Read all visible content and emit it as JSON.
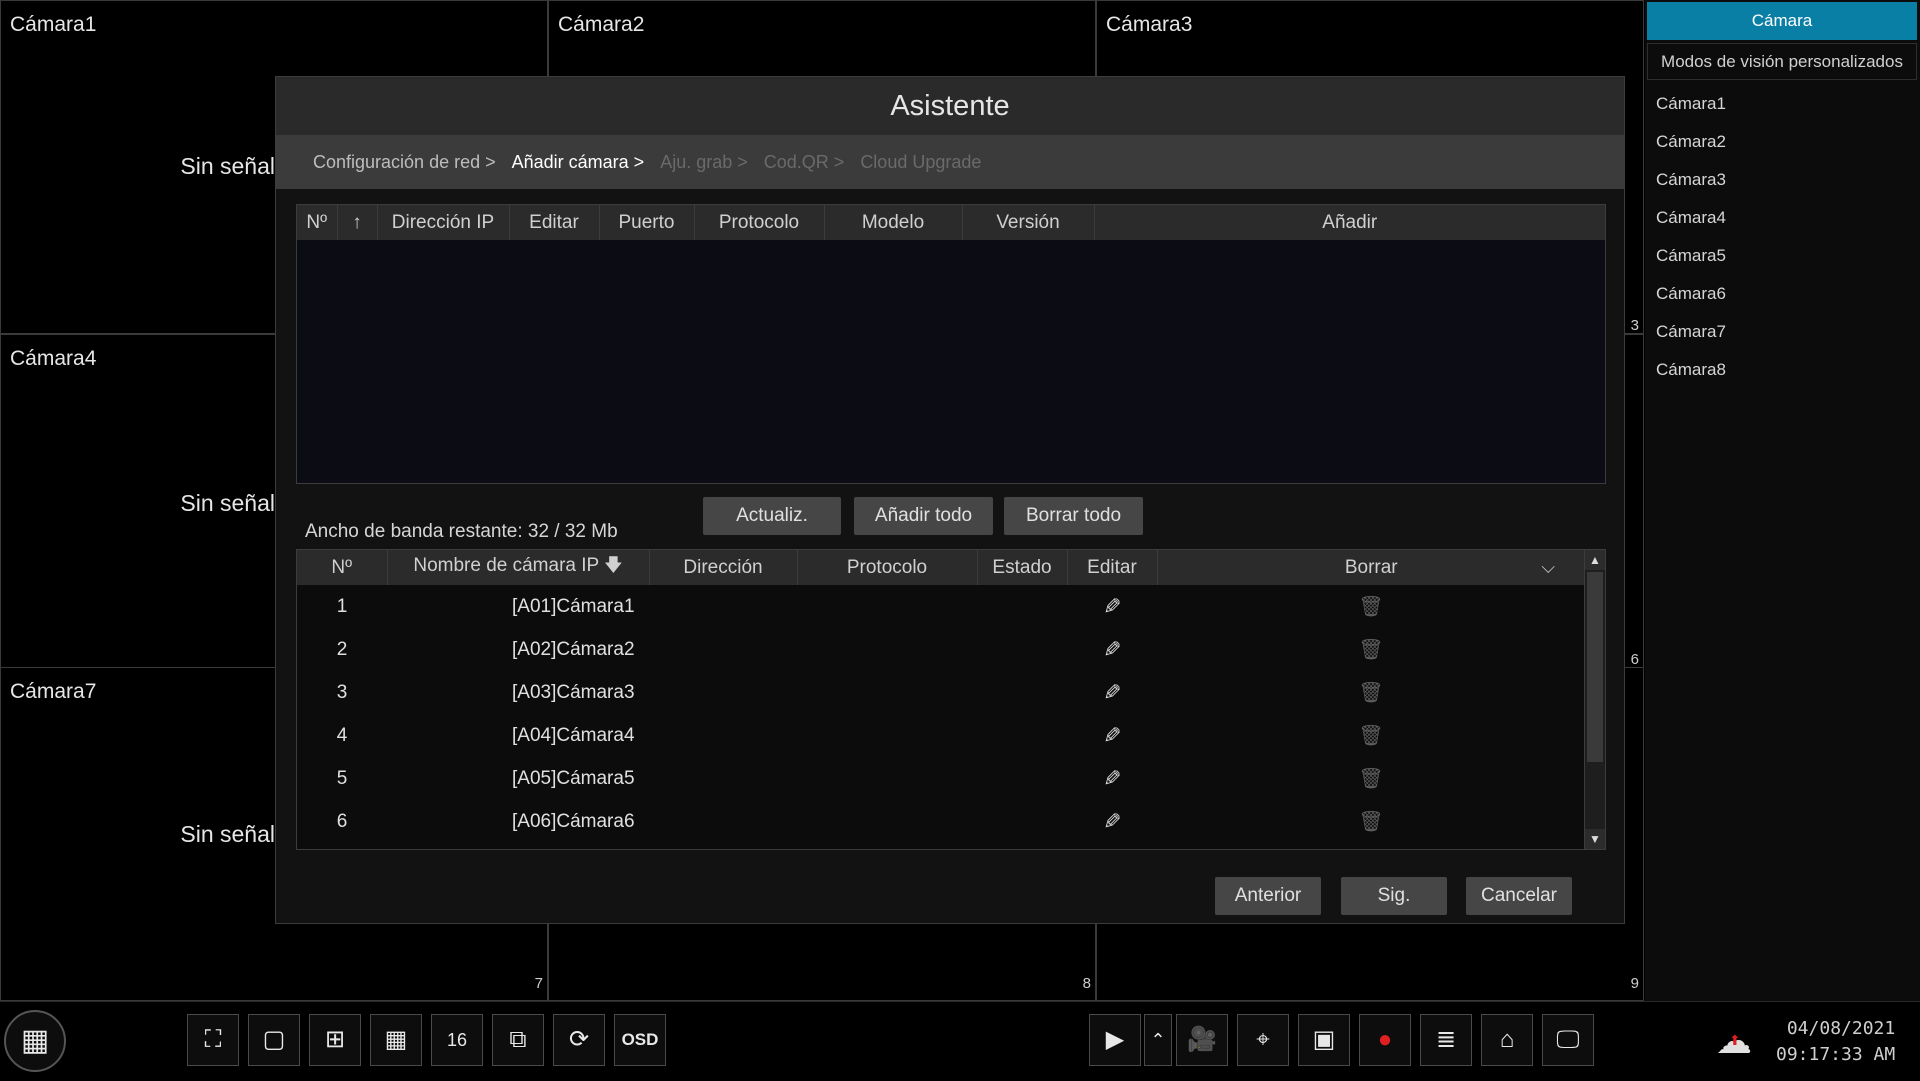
{
  "cameras": [
    {
      "title": "Cámara1",
      "status": "Sin señal"
    },
    {
      "title": "Cámara2",
      "status": ""
    },
    {
      "title": "Cámara3",
      "status": ""
    },
    {
      "title": "Cámara4",
      "status": "Sin señal"
    },
    {
      "title": "Cámara7",
      "status": "Sin señal"
    }
  ],
  "cell_numbers": [
    "3",
    "6",
    "7",
    "8",
    "9"
  ],
  "right_panel": {
    "tab_camera": "Cámara",
    "tab_custom": "Modos de visión personalizados",
    "items": [
      "Cámara1",
      "Cámara2",
      "Cámara3",
      "Cámara4",
      "Cámara5",
      "Cámara6",
      "Cámara7",
      "Cámara8"
    ]
  },
  "wizard": {
    "title": "Asistente",
    "steps": [
      "Configuración de red >",
      "Añadir cámara >",
      "Aju. grab >",
      "Cod.QR >",
      "Cloud Upgrade"
    ],
    "scan_table": {
      "columns": [
        "Nº",
        "↑",
        "Dirección IP",
        "Editar",
        "Puerto",
        "Protocolo",
        "Modelo",
        "Versión",
        "Añadir"
      ]
    },
    "buttons": {
      "refresh": "Actualiz.",
      "add_all": "Añadir todo",
      "delete_all": "Borrar todo"
    },
    "bandwidth": "Ancho de banda restante: 32 / 32 Mb",
    "added_table": {
      "columns": [
        "Nº",
        "Nombre de cámara IP",
        "Dirección",
        "Protocolo",
        "Estado",
        "Editar",
        "Borrar"
      ],
      "sort_icon": "arrow-down-icon",
      "rows": [
        {
          "no": "1",
          "name": "[A01]Cámara1"
        },
        {
          "no": "2",
          "name": "[A02]Cámara2"
        },
        {
          "no": "3",
          "name": "[A03]Cámara3"
        },
        {
          "no": "4",
          "name": "[A04]Cámara4"
        },
        {
          "no": "5",
          "name": "[A05]Cámara5"
        },
        {
          "no": "6",
          "name": "[A06]Cámara6"
        }
      ]
    },
    "nav": {
      "prev": "Anterior",
      "next": "Sig.",
      "cancel": "Cancelar"
    }
  },
  "taskbar": {
    "osd_label": "OSD",
    "layout_16_label": "16",
    "date": "04/08/2021",
    "time": "09:17:33 AM"
  },
  "colors": {
    "accent": "#0a7fa5",
    "alarm": "#e02020"
  }
}
